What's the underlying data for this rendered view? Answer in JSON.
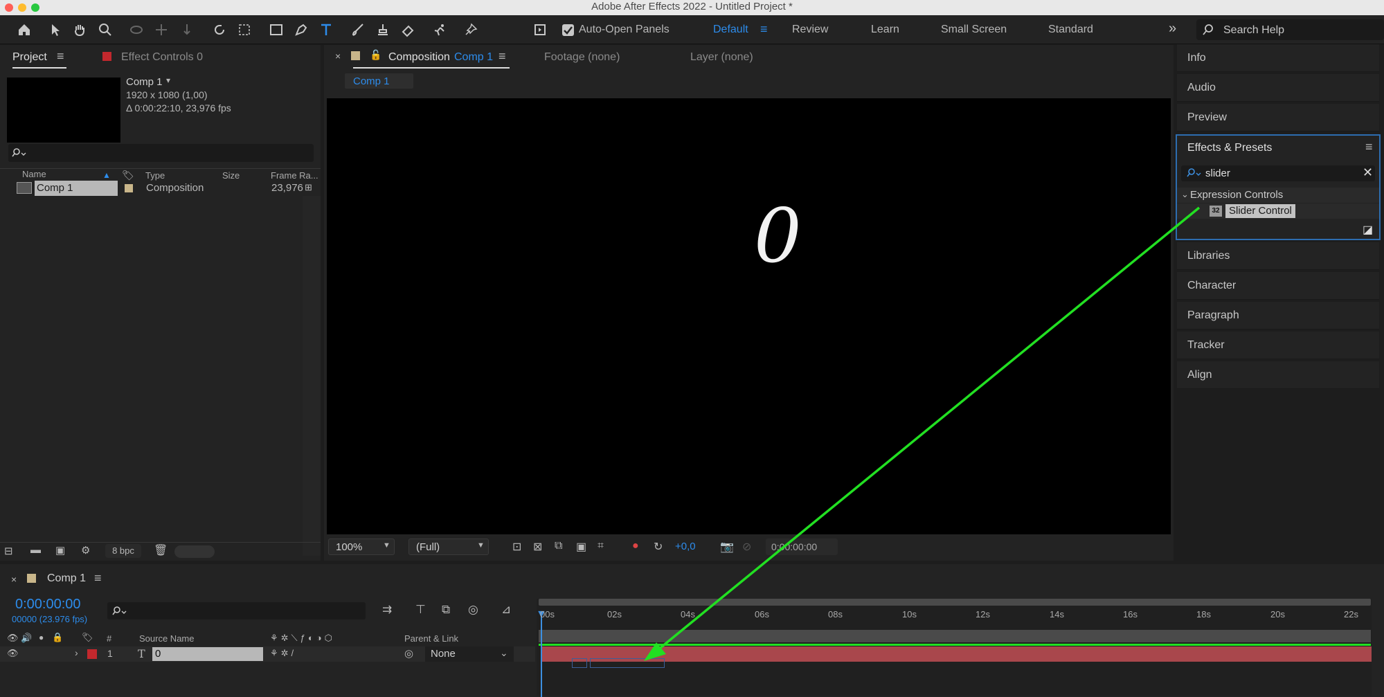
{
  "window": {
    "title": "Adobe After Effects 2022 - Untitled Project *"
  },
  "toolbar": {
    "auto_open_panels": "Auto-Open Panels",
    "workspaces": [
      "Default",
      "Review",
      "Learn",
      "Small Screen",
      "Standard"
    ],
    "search_help": "Search Help"
  },
  "project_panel": {
    "tab_project": "Project",
    "tab_effect_controls": "Effect Controls 0",
    "item_name": "Comp 1",
    "item_dims": "1920 x 1080 (1,00)",
    "item_duration": "Δ 0:00:22:10, 23,976 fps",
    "columns": {
      "name": "Name",
      "type": "Type",
      "size": "Size",
      "frame_rate": "Frame Ra..."
    },
    "rows": [
      {
        "name": "Comp 1",
        "type": "Composition",
        "frame_rate": "23,976"
      }
    ],
    "bpc": "8 bpc"
  },
  "viewer": {
    "tab_composition": "Composition",
    "tab_comp_name": "Comp 1",
    "tab_footage": "Footage (none)",
    "tab_layer": "Layer (none)",
    "breadcrumb": "Comp 1",
    "canvas_text": "0",
    "zoom": "100%",
    "resolution": "(Full)",
    "exposure": "+0,0",
    "timecode": "0:00:00:00"
  },
  "right_panels": {
    "info": "Info",
    "audio": "Audio",
    "preview": "Preview",
    "effects_presets": "Effects & Presets",
    "search_value": "slider",
    "category": "Expression Controls",
    "effect_item": "Slider Control",
    "effect_badge": "32",
    "libraries": "Libraries",
    "character": "Character",
    "paragraph": "Paragraph",
    "tracker": "Tracker",
    "align": "Align"
  },
  "timeline": {
    "tab": "Comp 1",
    "timecode": "0:00:00:00",
    "fps_sub": "00000 (23.976 fps)",
    "ruler": [
      "00s",
      "02s",
      "04s",
      "06s",
      "08s",
      "10s",
      "12s",
      "14s",
      "16s",
      "18s",
      "20s",
      "22s"
    ],
    "columns": {
      "num": "#",
      "source": "Source Name",
      "parent": "Parent & Link"
    },
    "layer": {
      "num": "1",
      "type_glyph": "T",
      "name": "0",
      "parent": "None"
    }
  },
  "colors": {
    "accent": "#2d8ceb",
    "annotation": "#22e022",
    "layer_bar": "#a9474c",
    "label_red": "#c2282d"
  }
}
